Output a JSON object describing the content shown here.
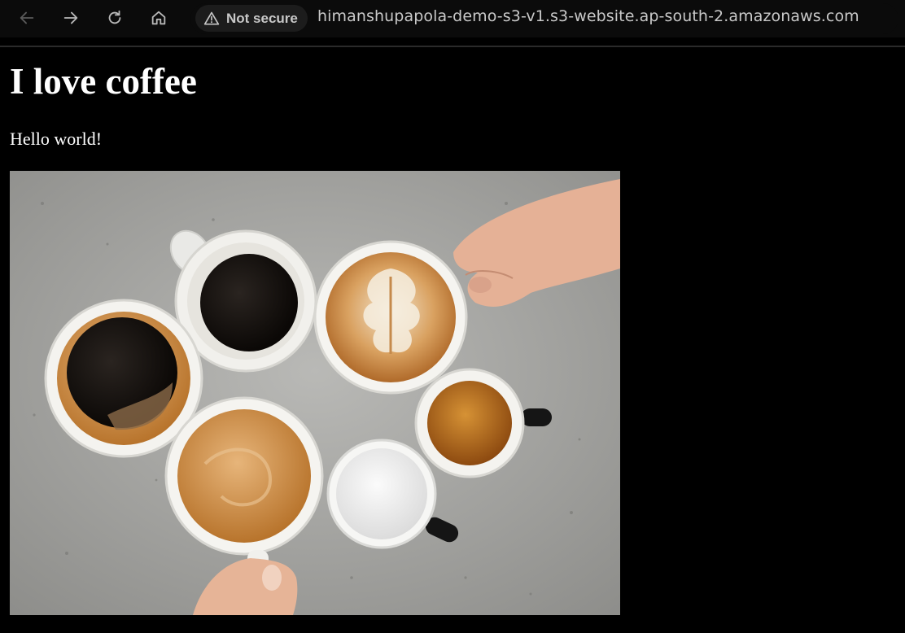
{
  "browser": {
    "security_label": "Not secure",
    "url": "himanshupapola-demo-s3-v1.s3-website.ap-south-2.amazonaws.com",
    "icons": [
      "back-arrow-icon",
      "forward-arrow-icon",
      "reload-icon",
      "home-icon",
      "warning-icon"
    ]
  },
  "page": {
    "heading": "I love coffee",
    "text": "Hello world!",
    "image": {
      "subject": "coffee-cups-photo"
    }
  },
  "colors": {
    "page_background": "#000000",
    "page_text": "#ffffff",
    "toolbar_background": "#0b0b0b",
    "url_text": "#c9c9c9"
  }
}
